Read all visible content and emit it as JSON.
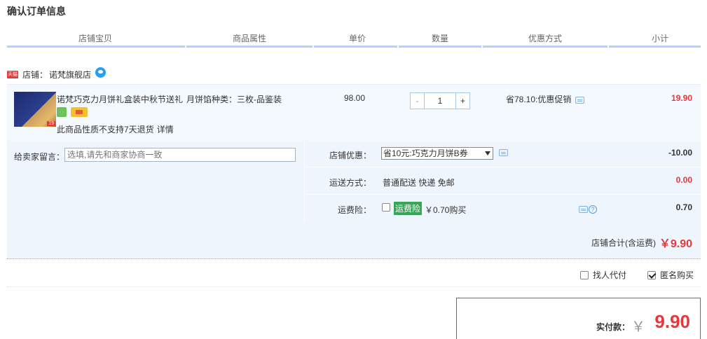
{
  "page_title": "确认订单信息",
  "columns": [
    "店铺宝贝",
    "商品属性",
    "单价",
    "数量",
    "优惠方式",
    "小计"
  ],
  "shop": {
    "badge": "天猫",
    "label": "店铺：",
    "name": "诺梵旗舰店"
  },
  "item": {
    "name": "诺梵巧克力月饼礼盒装中秋节送礼",
    "thumb_tag": "19",
    "attribute": "月饼馅种类：三枚-品鉴装",
    "price": "98.00",
    "quantity": "1",
    "minus_label": "-",
    "plus_label": "+",
    "discount": "省78.10:优惠促销",
    "subtotal": "19.90",
    "return_notice": "此商品性质不支持7天退货",
    "detail_link": "详情"
  },
  "message": {
    "label": "给卖家留言：",
    "placeholder": "选填,请先和商家协商一致"
  },
  "shop_coupon": {
    "label": "店铺优惠：",
    "selected": "省10元:巧克力月饼B券",
    "amount": "-10.00"
  },
  "shipping": {
    "label": "运送方式：",
    "value": "普通配送 快递 免邮",
    "amount": "0.00"
  },
  "insurance": {
    "label": "运费险：",
    "tag": "运费险",
    "price": "￥0.70购买",
    "help": "?",
    "amount": "0.70"
  },
  "shop_total": {
    "label": "店铺合计(含运费)",
    "amount": "￥9.90"
  },
  "options": {
    "proxy_pay": "找人代付",
    "anonymous": "匿名购买"
  },
  "payment": {
    "label": "实付款：",
    "yen": "￥",
    "amount": "9.90"
  },
  "colors": {
    "accent_red": "#e4393c",
    "header_line": "#b2d1ff",
    "panel_bg": "#eff5fc",
    "insure_green": "#39a657"
  }
}
